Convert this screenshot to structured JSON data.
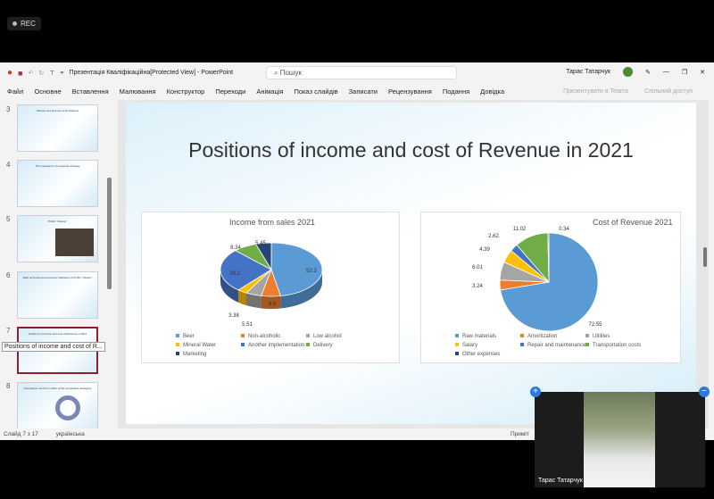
{
  "recorder": {
    "label": "REC"
  },
  "titlebar": {
    "title": "Презентація Кваліфікаційна[Protected View] - PowerPoint",
    "search_placeholder": "Пошук",
    "user": "Тарас Татарчук"
  },
  "menu": {
    "items": [
      "Файл",
      "Основне",
      "Вставлення",
      "Малювання",
      "Конструктор",
      "Переходи",
      "Анімація",
      "Показ слайдів",
      "Записати",
      "Рецензування",
      "Подання",
      "Довідка"
    ],
    "present_teams": "Презентувати в Teams",
    "share": "Спільний доступ"
  },
  "thumbnails": [
    {
      "num": "3",
      "title": "Mission and purpose of innovations"
    },
    {
      "num": "4",
      "title": "The importance of enterprise strategy"
    },
    {
      "num": "5",
      "title": "PrJSC \"Obolon\""
    },
    {
      "num": "6",
      "title": "Main technical and economic indicators of PrJSC \"Obolon\""
    },
    {
      "num": "7",
      "title": "Positions of income and cost of Revenue in 2021"
    },
    {
      "num": "8",
      "title": "Comparison and the conflict of the competitive strategies"
    }
  ],
  "tooltip": "Positions of income and cost of R...",
  "slide": {
    "title": "Positions of income and cost of Revenue in 2021"
  },
  "chart_data": [
    {
      "type": "pie",
      "title": "Income from sales 2021",
      "categories": [
        "Beer",
        "Non-alcoholic",
        "Low alcohol",
        "Mineral Water",
        "Another implementation",
        "Delivery",
        "Marketing"
      ],
      "values": [
        52.2,
        6.8,
        5.51,
        3.38,
        29.2,
        8.34,
        5.45
      ],
      "labels": [
        "52.2",
        "6.8",
        "5.51",
        "3.38",
        "29.2",
        "8.34",
        "5.45"
      ],
      "colors": [
        "#5b9bd5",
        "#ed7d31",
        "#a5a5a5",
        "#ffc000",
        "#4472c4",
        "#70ad47",
        "#264478"
      ],
      "legend": "bottom"
    },
    {
      "type": "pie",
      "title": "Cost of Revenue 2021",
      "categories": [
        "Raw materials",
        "Amortization",
        "Utilities",
        "Salary",
        "Repair and maintenance",
        "Transportation costs",
        "Other expenses"
      ],
      "values": [
        72.55,
        3.24,
        6.01,
        4.39,
        2.62,
        11.02,
        0.34
      ],
      "labels": [
        "72.55",
        "3.24",
        "6.01",
        "4.39",
        "2.62",
        "11.02",
        "0.34"
      ],
      "colors": [
        "#5b9bd5",
        "#ed7d31",
        "#a5a5a5",
        "#ffc000",
        "#4472c4",
        "#70ad47",
        "#264478"
      ],
      "legend": "bottom"
    }
  ],
  "status": {
    "slide": "Слайд 7 з 17",
    "lang": "українська",
    "notes": "Приміт"
  },
  "video": {
    "name": "Тарас Татарчук"
  }
}
